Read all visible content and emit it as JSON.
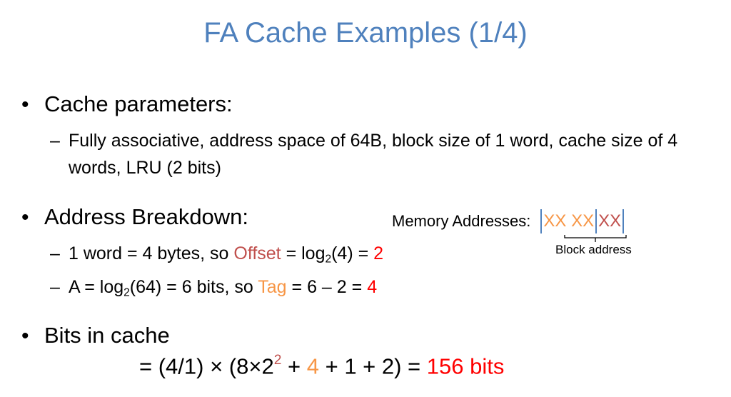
{
  "title": "FA Cache Examples (1/4)",
  "bullets": {
    "b1": "Cache parameters:",
    "b1_sub": "Fully associative, address space of 64B, block size of 1 word, cache size of 4 words, LRU (2 bits)",
    "b2": "Address Breakdown:",
    "b2_sub1": {
      "pre": "1 word = 4 bytes, so ",
      "offset_word": "Offset",
      "eq": " = log",
      "base": "2",
      "arg": "(4) = ",
      "result": "2"
    },
    "b2_sub2": {
      "pre": "A = log",
      "base": "2",
      "mid": "(64) = 6 bits, so ",
      "tag_word": "Tag",
      "eq": " = 6 – 2 = ",
      "result": "4"
    },
    "b3": "Bits in cache",
    "formula": {
      "part1": "= (4/1) × (8×2",
      "exp": "2",
      "plus1": " + ",
      "tag": "4",
      "part2": " + 1 + 2) = ",
      "result": "156 bits"
    }
  },
  "memory": {
    "label": "Memory Addresses:",
    "tag_bits": "XX XX",
    "offset_bits": "XX",
    "block_label": "Block address"
  },
  "colors": {
    "title": "#4f81bd",
    "offset": "#c0504d",
    "tag": "#f79646",
    "result": "#ff0000"
  }
}
